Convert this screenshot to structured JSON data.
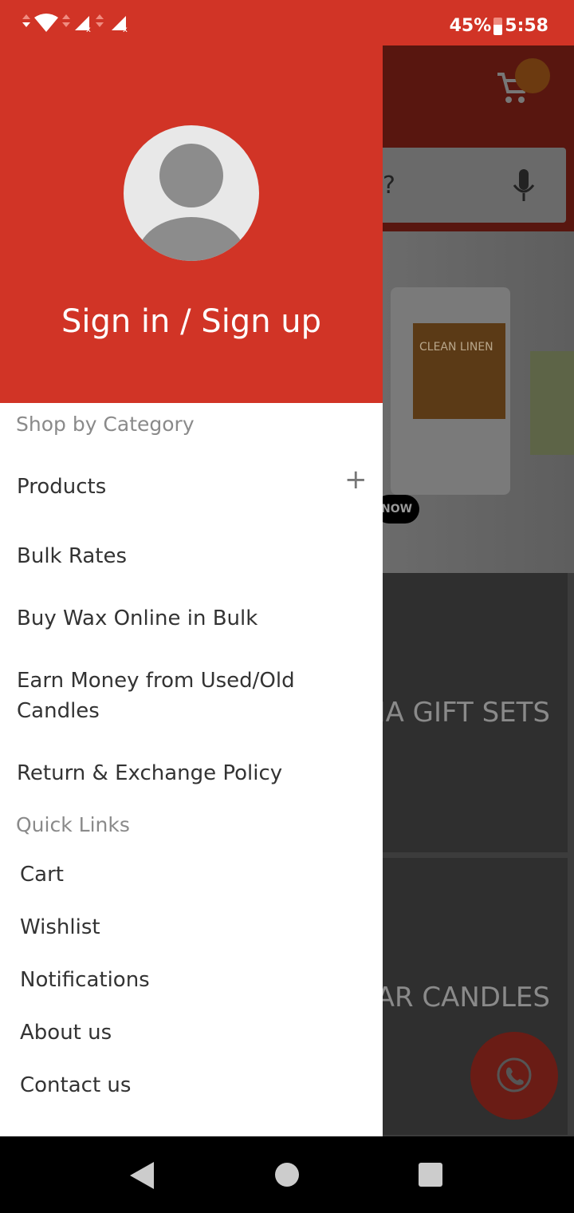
{
  "status_bar": {
    "battery": "45%",
    "time": "5:58"
  },
  "background": {
    "search_partial": "?",
    "banner_button_partial": "NOW",
    "candle_label": "CLEAN LINEN",
    "card1_partial": "MA GIFT SETS",
    "card2_partial": "AR CANDLES"
  },
  "drawer": {
    "sign_in": "Sign in / Sign up",
    "category_header": "Shop by Category",
    "categories": [
      {
        "label": "Products"
      },
      {
        "label": "Bulk Rates"
      },
      {
        "label": "Buy Wax Online in Bulk"
      },
      {
        "label": "Earn Money from Used/Old Candles"
      },
      {
        "label": "Return & Exchange Policy"
      }
    ],
    "quick_header": "Quick Links",
    "quick_links": [
      {
        "label": "Cart"
      },
      {
        "label": "Wishlist"
      },
      {
        "label": "Notifications"
      },
      {
        "label": "About us"
      },
      {
        "label": "Contact us"
      }
    ]
  },
  "colors": {
    "brand": "#d13426"
  }
}
